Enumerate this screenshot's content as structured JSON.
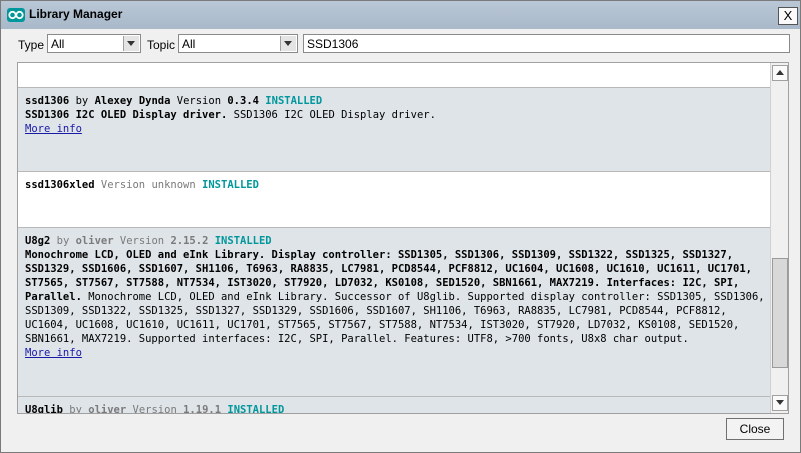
{
  "window": {
    "title": "Library Manager",
    "close_glyph": "X"
  },
  "filters": {
    "type_label": "Type",
    "type_value": "All",
    "topic_label": "Topic",
    "topic_value": "All",
    "search_value": "SSD1306"
  },
  "libraries": [
    {
      "name": "ssd1306",
      "by_word": "by",
      "author": "Alexey Dynda",
      "version_word": "Version",
      "version": "0.3.4",
      "status": "INSTALLED",
      "sentence": "SSD1306 I2C OLED Display driver.",
      "paragraph": "SSD1306 I2C OLED Display driver.",
      "more_info": "More info"
    },
    {
      "name": "ssd1306xled",
      "version_text": "Version unknown",
      "status": "INSTALLED"
    },
    {
      "name": "U8g2",
      "by_word": "by",
      "author": "oliver",
      "version_word": "Version",
      "version": "2.15.2",
      "status": "INSTALLED",
      "sentence_lines": [
        "Monochrome LCD, OLED and eInk Library. Display controller: SSD1305, SSD1306, SSD1309, SSD1322, SSD1325, SSD1327,",
        "SSD1329, SSD1606, SSD1607, SH1106, T6963, RA8835, LC7981, PCD8544, PCF8812, UC1604, UC1608, UC1610, UC1611, UC1701,",
        "ST7565, ST7567, ST7588, NT7534, IST3020, ST7920, LD7032, KS0108, SED1520, SBN1661, MAX7219. Interfaces: I2C, SPI,",
        "Parallel."
      ],
      "paragraph_first": " Monochrome LCD, OLED and eInk Library. Successor of U8glib. Supported display controller: SSD1305, SSD1306,",
      "paragraph_lines": [
        "SSD1309, SSD1322, SSD1325, SSD1327, SSD1329, SSD1606, SSD1607, SH1106, T6963, RA8835, LC7981, PCD8544, PCF8812,",
        "UC1604, UC1608, UC1610, UC1611, UC1701, ST7565, ST7567, ST7588, NT7534, IST3020, ST7920, LD7032, KS0108, SED1520,",
        "SBN1661, MAX7219. Supported interfaces: I2C, SPI, Parallel. Features: UTF8, >700 fonts, U8x8 char output."
      ],
      "more_info": "More info"
    },
    {
      "name": "U8glib",
      "by_word": "by",
      "author": "oliver",
      "version_word": "Version",
      "version": "1.19.1",
      "status": "INSTALLED"
    }
  ],
  "footer": {
    "close_label": "Close"
  },
  "colors": {
    "installed": "#00979c",
    "link": "#1a1aa8",
    "selected_row": "#dfe4e8"
  },
  "icons": {
    "app": "arduino-infinity-icon"
  }
}
